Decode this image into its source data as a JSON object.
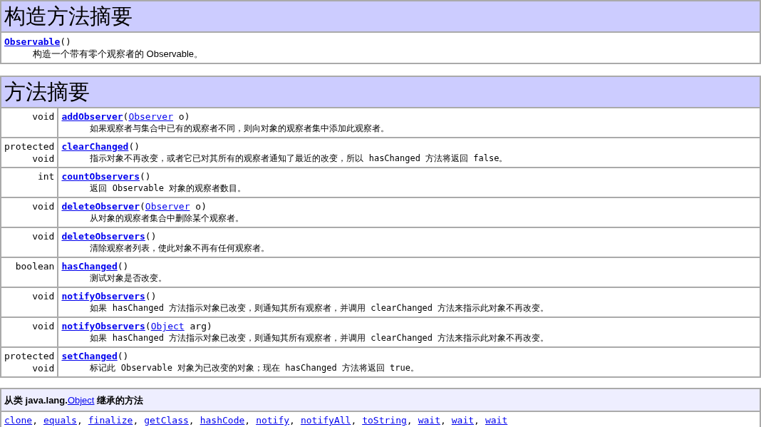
{
  "constructor_summary": {
    "title": "构造方法摘要",
    "constructors": [
      {
        "name": "Observable",
        "args": "()",
        "description": "构造一个带有零个观察者的 Observable。"
      }
    ]
  },
  "method_summary": {
    "title": "方法摘要",
    "methods": [
      {
        "modifier": "void",
        "name": "addObserver",
        "open": "(",
        "param_type": "Observer",
        "rest": " o)",
        "description": "如果观察者与集合中已有的观察者不同，则向对象的观察者集中添加此观察者。"
      },
      {
        "modifier": "protected void",
        "name": "clearChanged",
        "open": "()",
        "description": "指示对象不再改变，或者它已对其所有的观察者通知了最近的改变，所以 hasChanged 方法将返回 false。"
      },
      {
        "modifier": "int",
        "name": "countObservers",
        "open": "()",
        "description": "返回 Observable 对象的观察者数目。"
      },
      {
        "modifier": "void",
        "name": "deleteObserver",
        "open": "(",
        "param_type": "Observer",
        "rest": " o)",
        "description": "从对象的观察者集合中删除某个观察者。"
      },
      {
        "modifier": "void",
        "name": "deleteObservers",
        "open": "()",
        "description": "清除观察者列表，使此对象不再有任何观察者。"
      },
      {
        "modifier": "boolean",
        "name": "hasChanged",
        "open": "()",
        "description": "测试对象是否改变。"
      },
      {
        "modifier": "void",
        "name": "notifyObservers",
        "open": "()",
        "description": "如果 hasChanged 方法指示对象已改变，则通知其所有观察者，并调用 clearChanged 方法来指示此对象不再改变。"
      },
      {
        "modifier": "void",
        "name": "notifyObservers",
        "open": "(",
        "param_type": "Object",
        "rest": " arg)",
        "description": "如果 hasChanged 方法指示对象已改变，则通知其所有观察者，并调用 clearChanged 方法来指示此对象不再改变。"
      },
      {
        "modifier": "protected void",
        "name": "setChanged",
        "open": "()",
        "description": "标记此 Observable 对象为已改变的对象；现在 hasChanged 方法将返回 true。"
      }
    ]
  },
  "inherited": {
    "prefix": "从类 java.lang.",
    "class_link": "Object",
    "suffix": " 继承的方法",
    "separator": ",",
    "methods": [
      "clone",
      "equals",
      "finalize",
      "getClass",
      "hashCode",
      "notify",
      "notifyAll",
      "toString",
      "wait",
      "wait",
      "wait"
    ]
  }
}
